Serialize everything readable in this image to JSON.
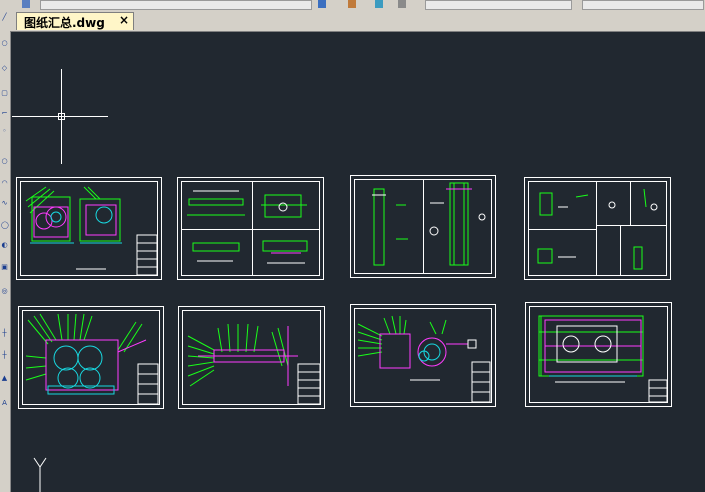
{
  "document_tab": {
    "title": "图纸汇总.dwg",
    "close_glyph": "×"
  },
  "ucs": {
    "y_label": "Y"
  },
  "colors": {
    "background": "#212830",
    "sheet_border": "#ffffff",
    "geometry_green": "#19ff19",
    "geometry_magenta": "#ff3cff",
    "geometry_cyan": "#18d8e0",
    "geometry_white": "#ffffff"
  },
  "sheets": [
    {
      "name": "drawing-sheet-1"
    },
    {
      "name": "drawing-sheet-2"
    },
    {
      "name": "drawing-sheet-3"
    },
    {
      "name": "drawing-sheet-4"
    },
    {
      "name": "drawing-sheet-5"
    },
    {
      "name": "drawing-sheet-6"
    },
    {
      "name": "drawing-sheet-7"
    },
    {
      "name": "drawing-sheet-8"
    }
  ]
}
